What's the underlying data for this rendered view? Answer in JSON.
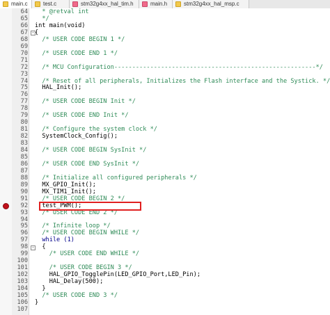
{
  "tabs": [
    {
      "label": "main.c",
      "type": "c",
      "active": true
    },
    {
      "label": "test.c",
      "type": "c",
      "active": false
    },
    {
      "label": "stm32g4xx_hal_tim.h",
      "type": "h",
      "active": false
    },
    {
      "label": "main.h",
      "type": "h",
      "active": false
    },
    {
      "label": "stm32g4xx_hal_msp.c",
      "type": "c",
      "active": false
    }
  ],
  "code_lines": [
    {
      "n": "64",
      "text": "  * @retval int",
      "kind": "comment"
    },
    {
      "n": "65",
      "text": "  */",
      "kind": "comment"
    },
    {
      "n": "66",
      "text": "int main(void)",
      "kind": "code"
    },
    {
      "n": "67",
      "text": "{",
      "kind": "code"
    },
    {
      "n": "68",
      "text": "  /* USER CODE BEGIN 1 */",
      "kind": "comment"
    },
    {
      "n": "69",
      "text": "",
      "kind": "code"
    },
    {
      "n": "70",
      "text": "  /* USER CODE END 1 */",
      "kind": "comment"
    },
    {
      "n": "71",
      "text": "",
      "kind": "code"
    },
    {
      "n": "72",
      "text": "  /* MCU Configuration--------------------------------------------------------*/",
      "kind": "comment"
    },
    {
      "n": "73",
      "text": "",
      "kind": "code"
    },
    {
      "n": "74",
      "text": "  /* Reset of all peripherals, Initializes the Flash interface and the Systick. */",
      "kind": "comment"
    },
    {
      "n": "75",
      "text": "  HAL_Init();",
      "kind": "code"
    },
    {
      "n": "76",
      "text": "",
      "kind": "code"
    },
    {
      "n": "77",
      "text": "  /* USER CODE BEGIN Init */",
      "kind": "comment"
    },
    {
      "n": "78",
      "text": "",
      "kind": "code"
    },
    {
      "n": "79",
      "text": "  /* USER CODE END Init */",
      "kind": "comment"
    },
    {
      "n": "80",
      "text": "",
      "kind": "code"
    },
    {
      "n": "81",
      "text": "  /* Configure the system clock */",
      "kind": "comment"
    },
    {
      "n": "82",
      "text": "  SystemClock_Config();",
      "kind": "code"
    },
    {
      "n": "83",
      "text": "",
      "kind": "code"
    },
    {
      "n": "84",
      "text": "  /* USER CODE BEGIN SysInit */",
      "kind": "comment"
    },
    {
      "n": "85",
      "text": "",
      "kind": "code"
    },
    {
      "n": "86",
      "text": "  /* USER CODE END SysInit */",
      "kind": "comment"
    },
    {
      "n": "87",
      "text": "",
      "kind": "code"
    },
    {
      "n": "88",
      "text": "  /* Initialize all configured peripherals */",
      "kind": "comment"
    },
    {
      "n": "89",
      "text": "  MX_GPIO_Init();",
      "kind": "code"
    },
    {
      "n": "90",
      "text": "  MX_TIM1_Init();",
      "kind": "code"
    },
    {
      "n": "91",
      "text": "  /* USER CODE BEGIN 2 */",
      "kind": "comment"
    },
    {
      "n": "92",
      "text": "  test_PWM();",
      "kind": "code"
    },
    {
      "n": "93",
      "text": "  /* USER CODE END 2 */",
      "kind": "comment"
    },
    {
      "n": "94",
      "text": "",
      "kind": "code"
    },
    {
      "n": "95",
      "text": "  /* Infinite loop */",
      "kind": "comment"
    },
    {
      "n": "96",
      "text": "  /* USER CODE BEGIN WHILE */",
      "kind": "comment"
    },
    {
      "n": "97",
      "text": "  while (1)",
      "kind": "keyword"
    },
    {
      "n": "98",
      "text": "  {",
      "kind": "code"
    },
    {
      "n": "99",
      "text": "    /* USER CODE END WHILE */",
      "kind": "comment"
    },
    {
      "n": "100",
      "text": "",
      "kind": "code"
    },
    {
      "n": "101",
      "text": "    /* USER CODE BEGIN 3 */",
      "kind": "comment"
    },
    {
      "n": "102",
      "text": "    HAL_GPIO_TogglePin(LED_GPIO_Port,LED_Pin);",
      "kind": "code"
    },
    {
      "n": "103",
      "text": "    HAL_Delay(500);",
      "kind": "code"
    },
    {
      "n": "104",
      "text": "  }",
      "kind": "code"
    },
    {
      "n": "105",
      "text": "  /* USER CODE END 3 */",
      "kind": "comment"
    },
    {
      "n": "106",
      "text": "}",
      "kind": "code"
    },
    {
      "n": "107",
      "text": "",
      "kind": "code"
    }
  ],
  "fold_markers": [
    {
      "line": "67",
      "symbol": "-"
    },
    {
      "line": "98",
      "symbol": "-"
    }
  ],
  "breakpoint_line": "92",
  "highlighted_line": "92",
  "colors": {
    "comment": "#2e8b57",
    "keyword": "#00008b",
    "breakpoint": "#c0101a",
    "highlight_border": "#e02020"
  }
}
